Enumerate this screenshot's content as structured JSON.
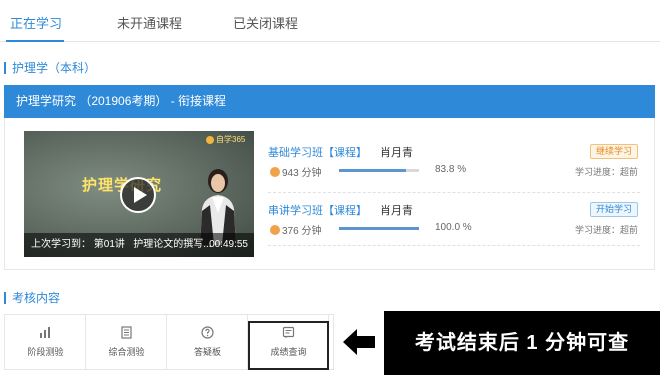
{
  "tabs": [
    {
      "label": "正在学习",
      "active": true
    },
    {
      "label": "未开通课程",
      "active": false
    },
    {
      "label": "已关闭课程",
      "active": false
    }
  ],
  "program": {
    "title": "护理学（本科）"
  },
  "course": {
    "title": "护理学研究 （201906考期） - 衔接课程",
    "video": {
      "cover_title": "护理学研究",
      "logo_text": "自学365",
      "last_study_label": "上次学习到：",
      "lecture": "第01讲",
      "lecture_title": "护理论文的撰写...",
      "time": "00:49:55"
    },
    "classes": [
      {
        "name": "基础学习班【课程】",
        "teacher": "肖月青",
        "minutes": "943 分钟",
        "progress": 0.838,
        "progress_text": "83.8 %",
        "button": "继续学习",
        "progress_label": "学习进度：超前",
        "accent": "#e58a1f"
      },
      {
        "name": "串讲学习班【课程】",
        "teacher": "肖月青",
        "minutes": "376 分钟",
        "progress": 1.0,
        "progress_text": "100.0 %",
        "button": "开始学习",
        "progress_label": "学习进度：超前",
        "accent": "#2e8ad8"
      }
    ]
  },
  "exam": {
    "title": "考核内容",
    "items": [
      {
        "label": "阶段测验",
        "icon": "bar-chart-icon"
      },
      {
        "label": "综合测验",
        "icon": "document-icon"
      },
      {
        "label": "答疑板",
        "icon": "question-icon"
      },
      {
        "label": "成绩查询",
        "icon": "score-icon",
        "highlighted": true
      }
    ]
  },
  "annotation": {
    "text": "考试结束后 1 分钟可查"
  },
  "colors": {
    "accent": "#2e8ad8",
    "orange": "#e58a1f",
    "callout_bg": "#000000"
  }
}
